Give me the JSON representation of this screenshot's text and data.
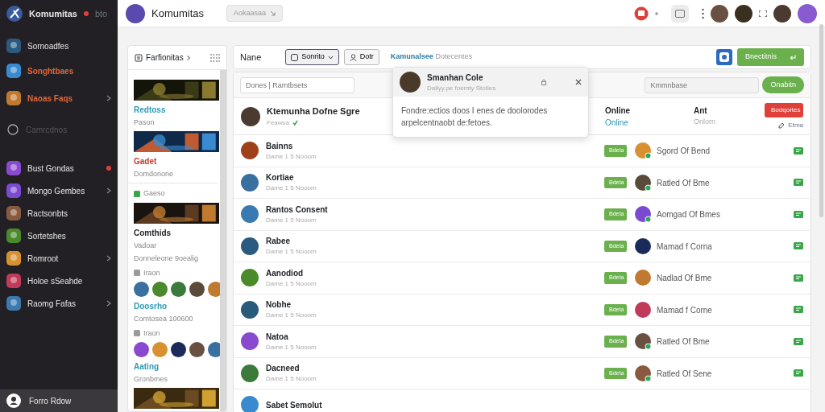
{
  "sidebar": {
    "brand": "Komumitas",
    "brand_badge": "bto",
    "items": [
      {
        "label": "Sornoadfes",
        "highlighted": false,
        "disabled": false,
        "chevron": false,
        "dot": false
      },
      {
        "label": "Songhtbaes",
        "highlighted": true,
        "disabled": false,
        "chevron": false,
        "dot": false
      },
      {
        "label": "Naoas Faqs",
        "highlighted": true,
        "disabled": false,
        "chevron": true,
        "dot": false
      },
      {
        "label": "Camrcdnos",
        "highlighted": false,
        "disabled": true,
        "chevron": false,
        "dot": false
      },
      {
        "label": "Bust Gondas",
        "highlighted": false,
        "disabled": false,
        "chevron": false,
        "dot": true
      },
      {
        "label": "Mongo Gembes",
        "highlighted": false,
        "disabled": false,
        "chevron": true,
        "dot": false
      },
      {
        "label": "Ractsonbts",
        "highlighted": false,
        "disabled": false,
        "chevron": false,
        "dot": false
      },
      {
        "label": "Sortetshes",
        "highlighted": false,
        "disabled": false,
        "chevron": false,
        "dot": false
      },
      {
        "label": "Romroot",
        "highlighted": false,
        "disabled": false,
        "chevron": true,
        "dot": false
      },
      {
        "label": "Holoe sSeahde",
        "highlighted": false,
        "disabled": false,
        "chevron": false,
        "dot": false
      },
      {
        "label": "Raomg Fafas",
        "highlighted": false,
        "disabled": false,
        "chevron": true,
        "dot": false
      }
    ],
    "footer": "Forro Rdow"
  },
  "topbar": {
    "title": "Komumitas",
    "search_chip": "Aokaasaa"
  },
  "favorites": {
    "title": "Farfionitas",
    "entries": [
      {
        "kind": "banner"
      },
      {
        "kind": "title",
        "text": "Redtoss",
        "color": "#2a9bb5"
      },
      {
        "kind": "text",
        "text": "Pason"
      },
      {
        "kind": "banner"
      },
      {
        "kind": "title",
        "text": "Gadet",
        "color": "#c0392b"
      },
      {
        "kind": "text",
        "text": "Domdonone"
      },
      {
        "kind": "divider"
      },
      {
        "kind": "meta",
        "text": "Gaeso",
        "color": "#3aa64a"
      },
      {
        "kind": "banner"
      },
      {
        "kind": "heading",
        "text": "Comthids"
      },
      {
        "kind": "text",
        "text": "Vadoar"
      },
      {
        "kind": "text",
        "text": "Donneleone 9oealig"
      },
      {
        "kind": "meta",
        "text": "Iraon",
        "color": "#9a9a9a"
      },
      {
        "kind": "avatars"
      },
      {
        "kind": "title",
        "text": "Doosrho",
        "color": "#2a9bb5"
      },
      {
        "kind": "text",
        "text": "Comtosea 100600"
      },
      {
        "kind": "meta",
        "text": "Iraon",
        "color": "#9a9a9a"
      },
      {
        "kind": "avatars"
      },
      {
        "kind": "title",
        "text": "Aating",
        "color": "#2a9bb5"
      },
      {
        "kind": "text",
        "text": "Gronbmes"
      },
      {
        "kind": "banner"
      }
    ]
  },
  "list": {
    "toolbar": {
      "label": "Nane",
      "sort": "Sonrito",
      "filter": "Dotr",
      "crumb_strong": "Kamunalsee",
      "crumb": "Dotecentes",
      "action": "Bnectitnis"
    },
    "filter_field": {
      "placeholder": "Dones | Ramtbsets"
    },
    "search_field": {
      "placeholder": "Kmmnbase"
    },
    "search_button": "Onabitn",
    "header": {
      "name": "Ktemunha Dofne Sgre",
      "sub": "Feawsa",
      "col1": "Online",
      "col1_sub": "Online",
      "col2": "Ant",
      "col2_sub": "Onlorn",
      "button": "Bodqortes",
      "link": "Etma"
    },
    "rows": [
      {
        "name": "Bainns",
        "sub": "Dame 1 5 Nooom",
        "badge": "Bdeta",
        "game": "Sgord Of Bend",
        "online": true
      },
      {
        "name": "Kortiae",
        "sub": "Dame 1 5 Nooom",
        "badge": "Bdeta",
        "game": "Ratled Of Bme",
        "online": true
      },
      {
        "name": "Rantos Consent",
        "sub": "Dame 1 5 Nooom",
        "badge": "Bdeta",
        "game": "Aomgad Of Bmes",
        "online": true
      },
      {
        "name": "Rabee",
        "sub": "Dame 1 5 Nooom",
        "badge": "Bdeta",
        "game": "Mamad f Corna",
        "online": false
      },
      {
        "name": "Aanodiod",
        "sub": "Dame 1 5 Nooom",
        "badge": "Bdeta",
        "game": "Nadlad Of Bme",
        "online": false
      },
      {
        "name": "Nobhe",
        "sub": "Dame 1 5 Nooom",
        "badge": "Bdeta",
        "game": "Mamad f Corne",
        "online": false
      },
      {
        "name": "Natoa",
        "sub": "Dame 1 5 Nooom",
        "badge": "Bdeta",
        "game": "Ratled Of Bme",
        "online": true
      },
      {
        "name": "Dacneed",
        "sub": "Dame 1 5 Nooom",
        "badge": "Bdeta",
        "game": "Ratled Of Sene",
        "online": true
      },
      {
        "name": "Sabet Semolut"
      }
    ]
  },
  "popover": {
    "name": "Smanhan Cole",
    "sub": "Dailyy.pe foemty Stotles",
    "body": "Fondre:ectios doos I enes de doolorodes arpelcentnaobt de:fetoes."
  }
}
